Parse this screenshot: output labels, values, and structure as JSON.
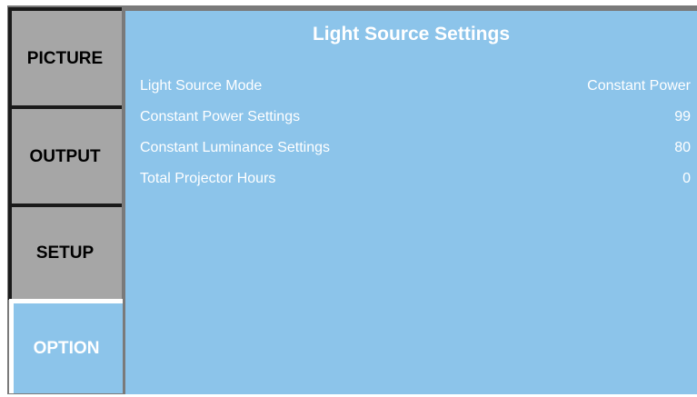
{
  "tabs": [
    {
      "label": "PICTURE",
      "active": false
    },
    {
      "label": "OUTPUT",
      "active": false
    },
    {
      "label": "SETUP",
      "active": false
    },
    {
      "label": "OPTION",
      "active": true
    }
  ],
  "panel": {
    "title": "Light Source Settings",
    "rows": [
      {
        "label": "Light Source Mode",
        "value": "Constant Power"
      },
      {
        "label": "Constant Power Settings",
        "value": "99"
      },
      {
        "label": "Constant Luminance Settings",
        "value": "80"
      },
      {
        "label": "Total Projector Hours",
        "value": "0"
      }
    ]
  },
  "colors": {
    "active_background": "#8cc4ea",
    "inactive_tab": "#a6a6a6",
    "frame": "#7a7a7a",
    "text_light": "#ffffff"
  }
}
